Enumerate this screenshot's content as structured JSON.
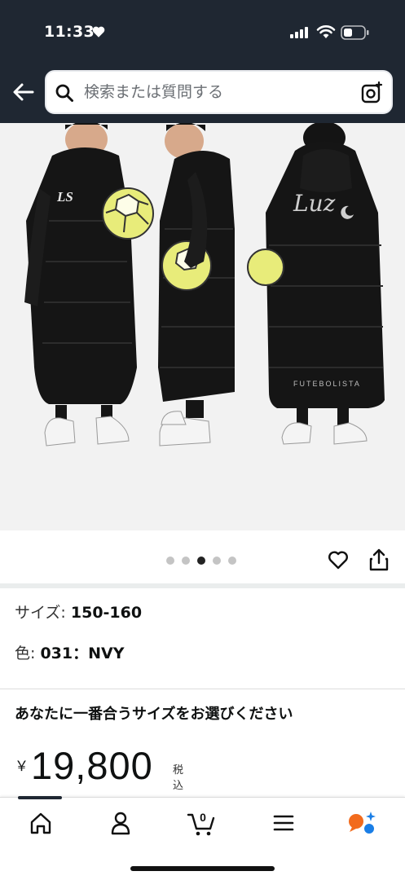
{
  "status_bar": {
    "time": "11:33"
  },
  "search": {
    "placeholder": "検索または質問する"
  },
  "carousel": {
    "page_count": 5,
    "active_index": 2
  },
  "product": {
    "jacket_back_text": "Luz",
    "jacket_hem_text": "FUTEBOLISTA",
    "jacket_logo_text": "LS",
    "size_label": "サイズ:",
    "size_value": "150-160",
    "color_label": "色:",
    "color_value": "031：NVY",
    "fit_prompt": "あなたに一番合うサイズをお選びください",
    "currency": "￥",
    "price": "19,800",
    "tax_note": "税込"
  },
  "bottom_nav": {
    "items": [
      "home-icon",
      "account-icon",
      "cart-icon",
      "menu-icon",
      "ai-assistant-icon"
    ],
    "cart_count": "0"
  },
  "colors": {
    "header_bg": "#1f2732",
    "separator": "#eaeded"
  }
}
